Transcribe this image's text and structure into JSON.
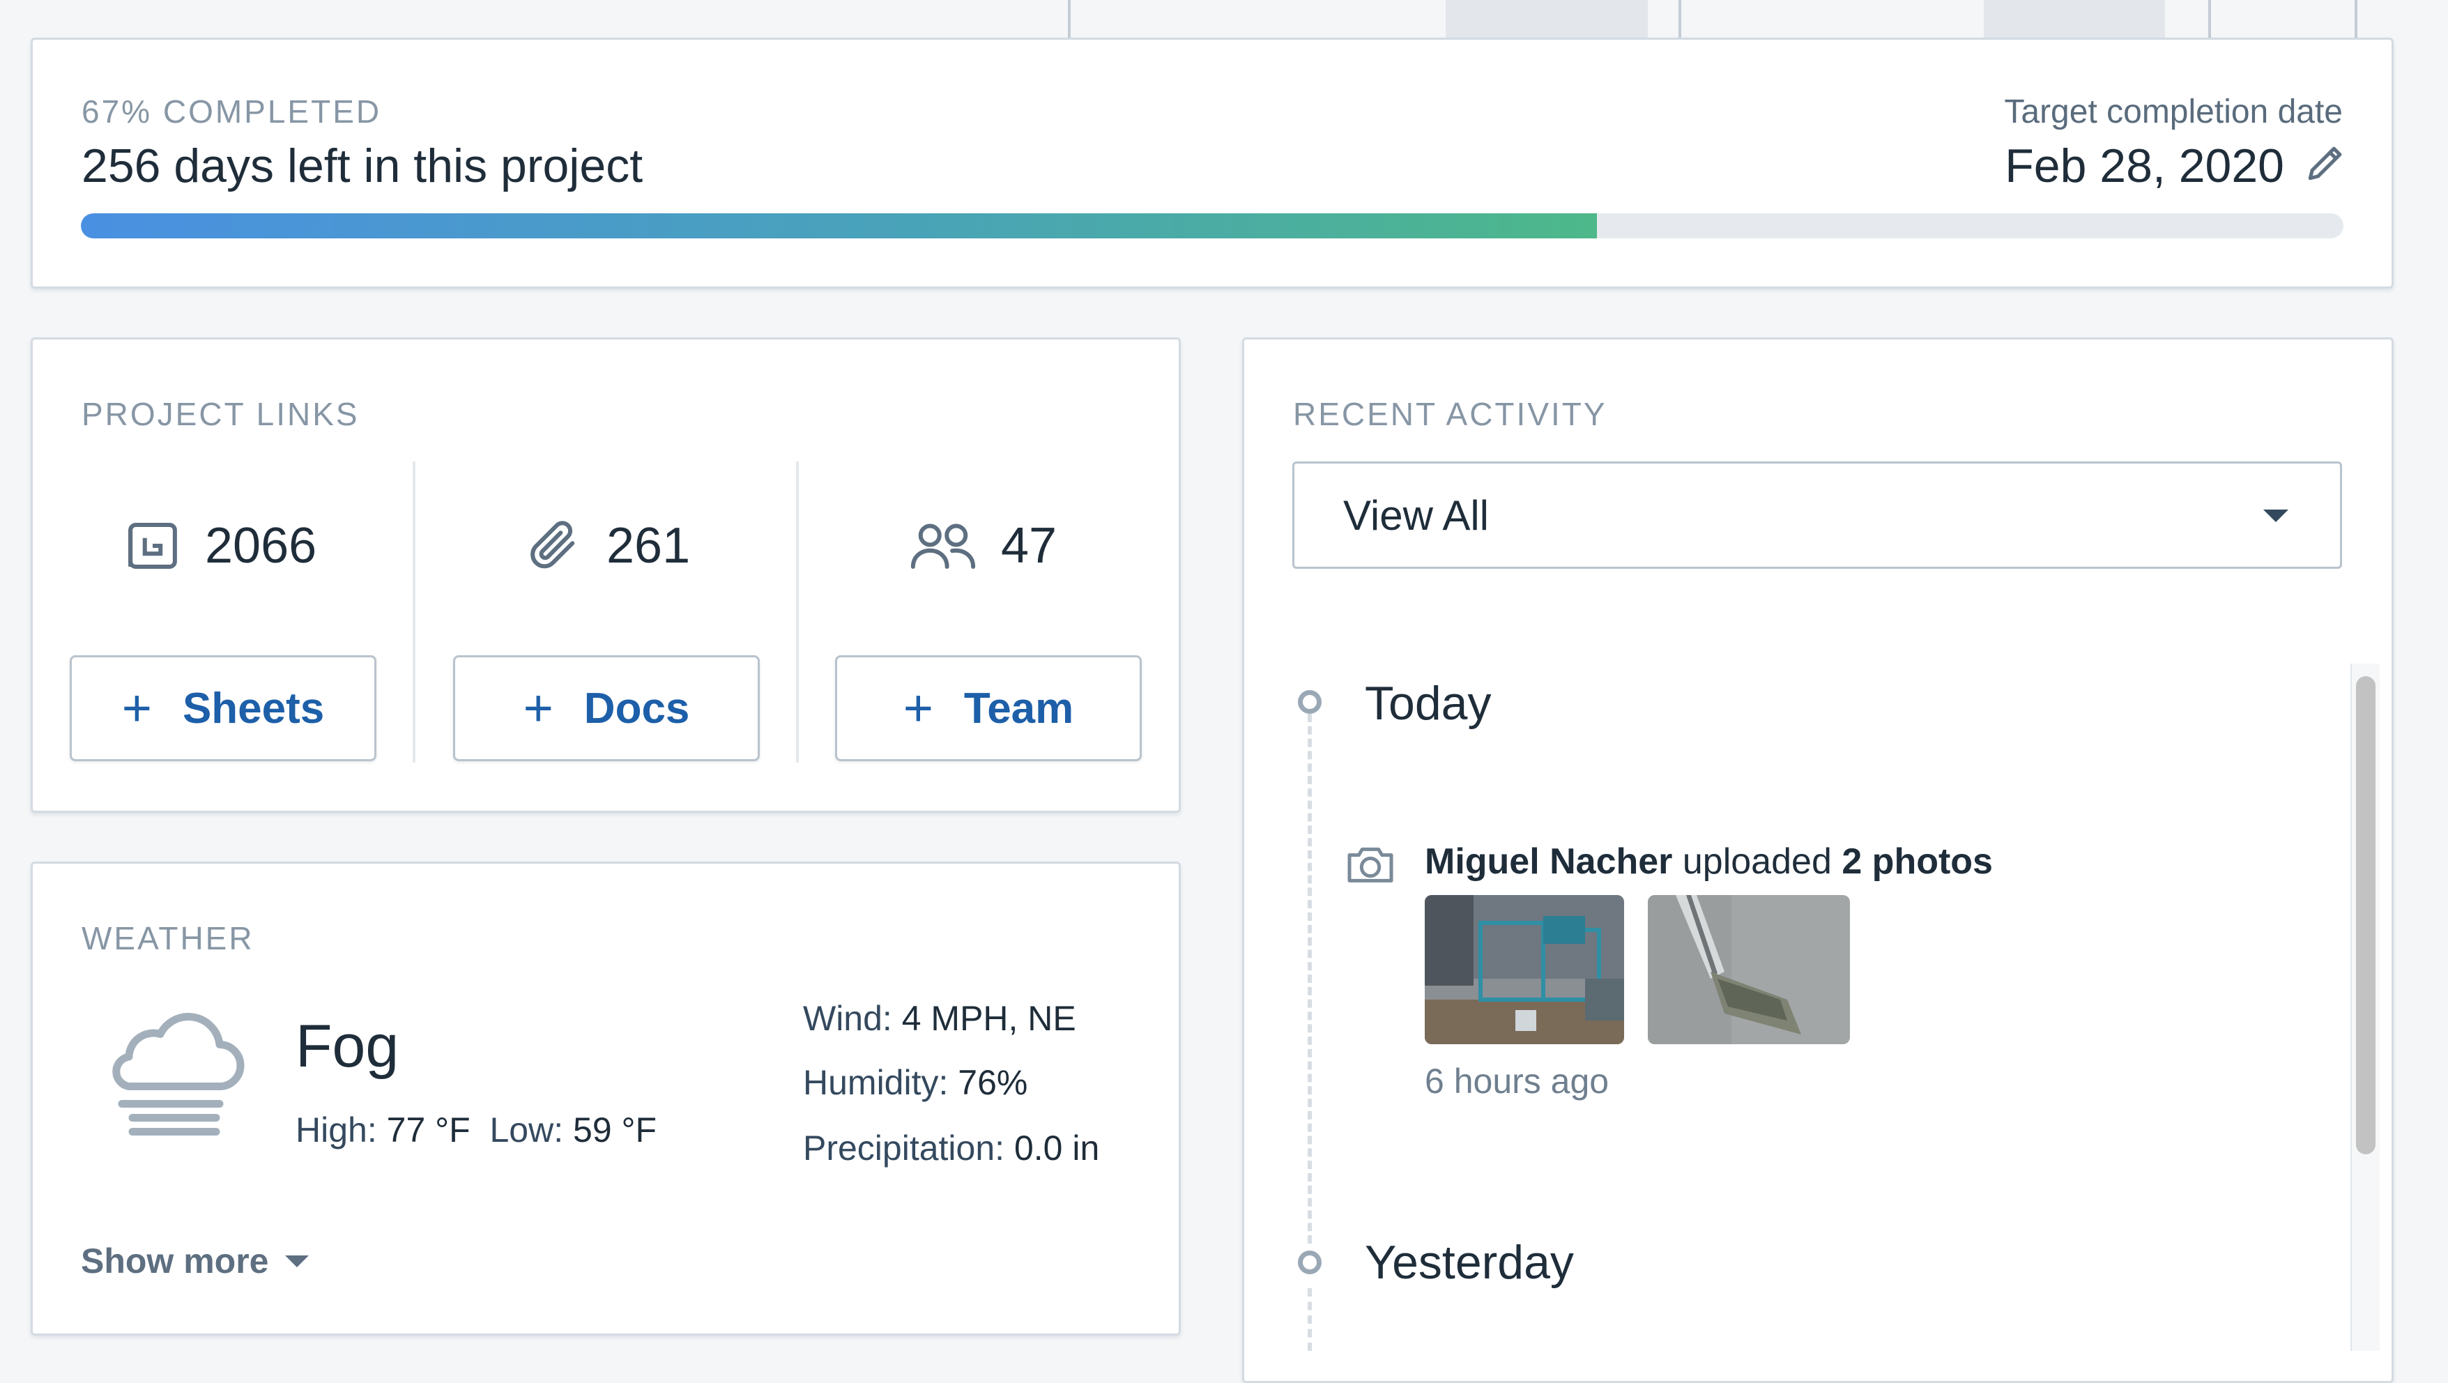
{
  "progress": {
    "percent_label": "67% COMPLETED",
    "percent": 67,
    "days_left": "256 days left in this project",
    "target_label": "Target completion date",
    "target_date": "Feb 28, 2020"
  },
  "project_links": {
    "title": "PROJECT LINKS",
    "sheets": {
      "count": "2066",
      "button": "Sheets",
      "icon": "sheets-icon"
    },
    "docs": {
      "count": "261",
      "button": "Docs",
      "icon": "paperclip-icon"
    },
    "team": {
      "count": "47",
      "button": "Team",
      "icon": "people-icon"
    },
    "plus": "+"
  },
  "weather": {
    "title": "WEATHER",
    "condition": "Fog",
    "high_label": "High:",
    "high": "77 °F",
    "low_label": "Low:",
    "low": "59 °F",
    "wind_label": "Wind:",
    "wind": "4 MPH, NE",
    "humidity_label": "Humidity:",
    "humidity": "76%",
    "precip_label": "Precipitation:",
    "precip": "0.0 in",
    "show_more": "Show more",
    "icon": "fog-cloud-icon"
  },
  "activity": {
    "title": "RECENT ACTIVITY",
    "filter": "View All",
    "groups": [
      {
        "label": "Today",
        "items": [
          {
            "user": "Miguel Nacher",
            "action": " uploaded ",
            "object": "2 photos",
            "time": "6 hours ago",
            "icon": "camera-icon"
          }
        ]
      },
      {
        "label": "Yesterday"
      }
    ]
  },
  "colors": {
    "accent": "#1d5fa8",
    "progress_start": "#4a90e2",
    "progress_end": "#4db88a",
    "muted": "#8796a5"
  }
}
